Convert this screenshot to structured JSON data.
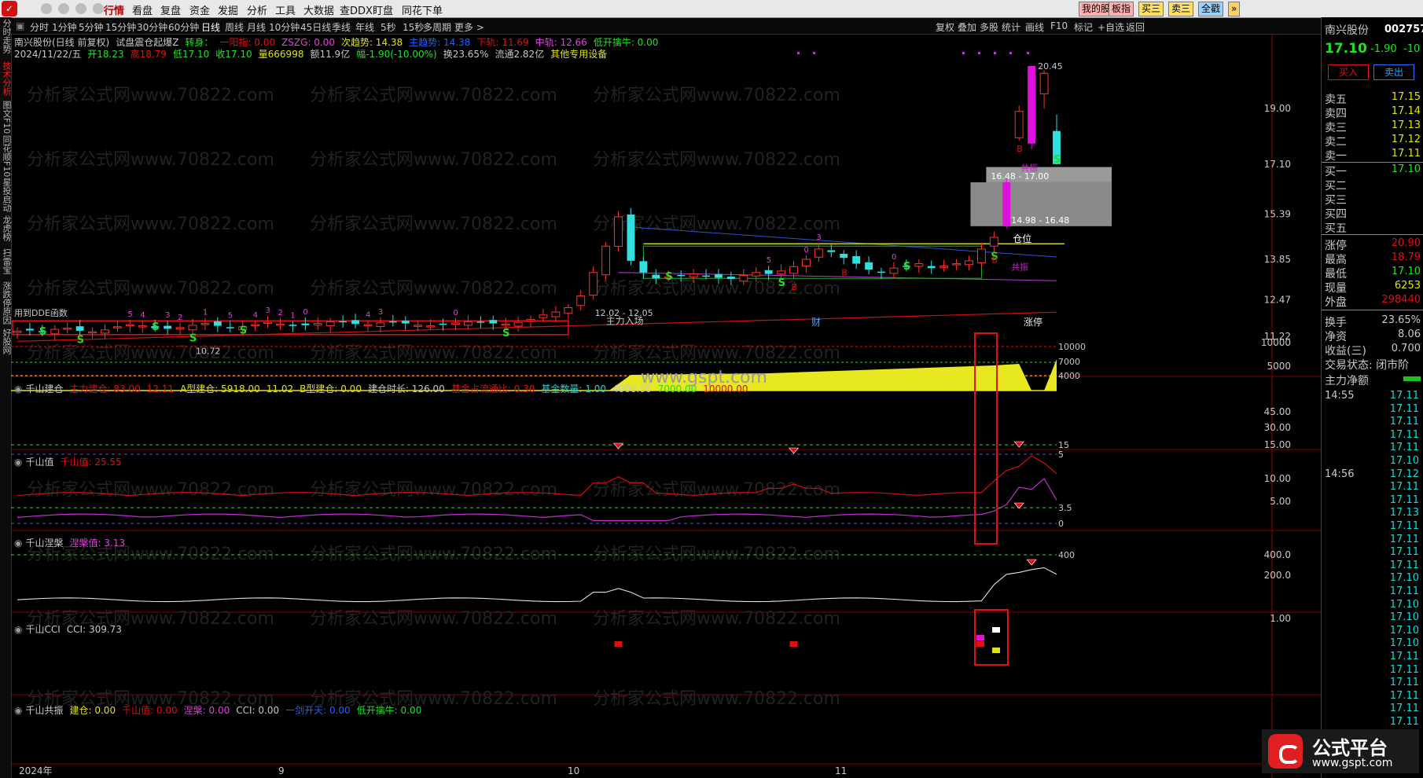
{
  "top_menu": {
    "items": [
      "行情",
      "看盘",
      "复盘",
      "资金",
      "发掘",
      "分析",
      "工具",
      "大数据",
      "查DDX",
      "盯盘",
      "同花下单"
    ],
    "active_index": 0,
    "right_buttons": [
      "我的股",
      "板指",
      "买三",
      "卖三",
      "全戳"
    ]
  },
  "period_bar": {
    "items": [
      "分时",
      "1分钟",
      "5分钟",
      "15分钟",
      "30分钟",
      "60分钟",
      "日线",
      "周线",
      "月线",
      "10分钟",
      "45日线",
      "季线",
      "年线",
      "5秒",
      "15秒",
      "多周期",
      "更多 >"
    ],
    "active_index": 6,
    "tools": [
      "复权",
      "叠加",
      "多股",
      "统计",
      "画线",
      "F10",
      "标记",
      "+自选",
      "返回"
    ]
  },
  "left_tabs": [
    "分时走势",
    "技术分析",
    "图文F10",
    "同花顺F10",
    "星投启动",
    "龙虎榜",
    "扫雷宝",
    "涨跌停原因",
    "好股网"
  ],
  "left_tabs_active": 1,
  "main_info": {
    "line1": [
      {
        "text": "南兴股份(日线 前复权)",
        "color": "#c8c8c8"
      },
      {
        "text": "试盘震仓起爆Z",
        "color": "#c8c8c8"
      },
      {
        "text": "转身：",
        "color": "#20e020"
      },
      {
        "text": "一阳指: 0.00",
        "color": "#e01010"
      },
      {
        "text": "ZSZG: 0.00",
        "color": "#e040e0"
      },
      {
        "text": "次趋势: 14.38",
        "color": "#e0e020"
      },
      {
        "text": "主趋势: 14.38",
        "color": "#2060ff"
      },
      {
        "text": "下轨: 11.69",
        "color": "#e01010"
      },
      {
        "text": "中轨: 12.66",
        "color": "#e040e0"
      },
      {
        "text": "低开擒牛: 0.00",
        "color": "#20e020"
      }
    ],
    "line2": [
      {
        "text": "2024/11/22/五",
        "color": "#c8c8c8"
      },
      {
        "text": "开18.23",
        "color": "#20e020"
      },
      {
        "text": "高18.79",
        "color": "#e01010"
      },
      {
        "text": "低17.10",
        "color": "#20e020"
      },
      {
        "text": "收17.10",
        "color": "#20e020"
      },
      {
        "text": "量666998",
        "color": "#e0e020"
      },
      {
        "text": "额11.9亿",
        "color": "#c8c8c8"
      },
      {
        "text": "幅-1.90(-10.00%)",
        "color": "#20e020"
      },
      {
        "text": "换23.65%",
        "color": "#c8c8c8"
      },
      {
        "text": "流通2.82亿",
        "color": "#c8c8c8"
      },
      {
        "text": "其他专用设备",
        "color": "#e0e020"
      }
    ]
  },
  "main_chart": {
    "price_axis": [
      "19.00",
      "17.10",
      "15.39",
      "13.85",
      "12.47",
      "11.22"
    ],
    "annotations": {
      "high_label": "20.45",
      "low_label": "10.72",
      "zone_upper": "16.48 - 17.00",
      "zone_lower": "14.98 - 16.48",
      "entry_range": "12.02 - 12.05",
      "entry_text": "主力入场",
      "pos_text": "仓位",
      "resonance_text": "共振",
      "resonance_text2": "共振",
      "caption": "用到DDE函数",
      "cai": "财",
      "zhangting": "涨停"
    }
  },
  "sub1": {
    "name": "千山建仓",
    "values": [
      {
        "text": "主力建仓: 83.00",
        "color": "#e01010"
      },
      {
        "text": "12.11",
        "color": "#e01010"
      },
      {
        "text": "A型建仓: 5918.00",
        "color": "#e0e020"
      },
      {
        "text": "11.02",
        "color": "#e0e020"
      },
      {
        "text": "B型建仓: 0.00",
        "color": "#e0e020"
      },
      {
        "text": "建仓时长: 126.00",
        "color": "#c8c8c8"
      },
      {
        "text": "基金占流通比: 0.30",
        "color": "#e01010"
      },
      {
        "text": "基金数量: 1.00",
        "color": "#18d8d8"
      },
      {
        "text": "4000.00",
        "color": "#c8c8c8"
      },
      {
        "text": "7000.00",
        "color": "#20e020"
      },
      {
        "text": "10000.00",
        "color": "#e01010"
      }
    ],
    "axis": [
      "10000",
      "5000"
    ],
    "inline_labels": [
      "10000",
      "7000",
      "4000"
    ]
  },
  "sub2": {
    "name": "千山值",
    "values": [
      {
        "text": "千山值: 25.55",
        "color": "#e01010"
      }
    ],
    "axis": [
      "45.00",
      "30.00",
      "15.00"
    ],
    "inline_labels": [
      "15",
      "5"
    ]
  },
  "sub3": {
    "name": "千山涅槃",
    "values": [
      {
        "text": "涅槃值: 3.13",
        "color": "#e040e0"
      }
    ],
    "axis": [
      "10.00",
      "5.00"
    ],
    "inline_labels": [
      "3.5",
      "0"
    ]
  },
  "sub4": {
    "name": "千山CCI",
    "values": [
      {
        "text": "CCI: 309.73",
        "color": "#c8c8c8"
      }
    ],
    "axis": [
      "400.0",
      "200.0"
    ],
    "inline_labels": [
      "400"
    ]
  },
  "sub5": {
    "name": "千山共振",
    "values": [
      {
        "text": "建仓: 0.00",
        "color": "#e0e020"
      },
      {
        "text": "千山值: 0.00",
        "color": "#e01010"
      },
      {
        "text": "涅槃: 0.00",
        "color": "#e040e0"
      },
      {
        "text": "CCI: 0.00",
        "color": "#c8c8c8"
      },
      {
        "text": "一剑开天: 0.00",
        "color": "#2060ff"
      },
      {
        "text": "低开擒牛: 0.00",
        "color": "#20e020"
      }
    ],
    "axis": [
      "1.00"
    ]
  },
  "x_axis": [
    "2024年",
    "9",
    "10",
    "11"
  ],
  "center_watermark": "www.gspt.com",
  "watermark_text": "分析家公式网www.70822.com",
  "right_panel": {
    "stock_name": "南兴股份",
    "stock_code": "002757",
    "price": "17.10",
    "change": "-1.90",
    "pct": "-10",
    "buy_btn": "买入",
    "sell_btn": "卖出",
    "asks": [
      {
        "k": "卖五",
        "v": "17.15"
      },
      {
        "k": "卖四",
        "v": "17.14"
      },
      {
        "k": "卖三",
        "v": "17.13"
      },
      {
        "k": "卖二",
        "v": "17.12"
      },
      {
        "k": "卖一",
        "v": "17.11"
      }
    ],
    "bids": [
      {
        "k": "买一",
        "v": "17.10"
      },
      {
        "k": "买二",
        "v": ""
      },
      {
        "k": "买三",
        "v": ""
      },
      {
        "k": "买四",
        "v": ""
      },
      {
        "k": "买五",
        "v": ""
      }
    ],
    "stats": [
      {
        "k": "涨停",
        "v": "20.90",
        "c": "#e01010"
      },
      {
        "k": "最高",
        "v": "18.79",
        "c": "#e01010"
      },
      {
        "k": "最低",
        "v": "17.10",
        "c": "#20e020"
      },
      {
        "k": "现量",
        "v": "6253",
        "c": "#e0e020"
      },
      {
        "k": "外盘",
        "v": "298440",
        "c": "#e01010"
      },
      {
        "k": "换手",
        "v": "23.65%",
        "c": "#c8c8c8"
      },
      {
        "k": "净资",
        "v": "8.06",
        "c": "#c8c8c8"
      },
      {
        "k": "收益(三)",
        "v": "0.700",
        "c": "#c8c8c8"
      }
    ],
    "trade_status": "交易状态: 闭市阶",
    "main_net": "主力净额",
    "ticks": [
      {
        "t": "14:55",
        "p": "17.11"
      },
      {
        "t": "",
        "p": "17.11"
      },
      {
        "t": "",
        "p": "17.11"
      },
      {
        "t": "",
        "p": "17.11"
      },
      {
        "t": "",
        "p": "17.11"
      },
      {
        "t": "",
        "p": "17.10"
      },
      {
        "t": "14:56",
        "p": "17.12"
      },
      {
        "t": "",
        "p": "17.11"
      },
      {
        "t": "",
        "p": "17.11"
      },
      {
        "t": "",
        "p": "17.13"
      },
      {
        "t": "",
        "p": "17.11"
      },
      {
        "t": "",
        "p": "17.11"
      },
      {
        "t": "",
        "p": "17.11"
      },
      {
        "t": "",
        "p": "17.11"
      },
      {
        "t": "",
        "p": "17.10"
      },
      {
        "t": "",
        "p": "17.11"
      },
      {
        "t": "",
        "p": "17.10"
      },
      {
        "t": "",
        "p": "17.10"
      },
      {
        "t": "",
        "p": "17.10"
      },
      {
        "t": "",
        "p": "17.10"
      },
      {
        "t": "",
        "p": "17.11"
      },
      {
        "t": "",
        "p": "17.11"
      },
      {
        "t": "",
        "p": "17.11"
      },
      {
        "t": "",
        "p": "17.11"
      },
      {
        "t": "",
        "p": "17.11"
      },
      {
        "t": "",
        "p": "17.11"
      },
      {
        "t": "",
        "p": "17.11"
      },
      {
        "t": "",
        "p": "17.11"
      },
      {
        "t": "",
        "p": "17.11"
      }
    ]
  },
  "brand": {
    "name": "公式平台",
    "url": "www.gspt.com"
  }
}
